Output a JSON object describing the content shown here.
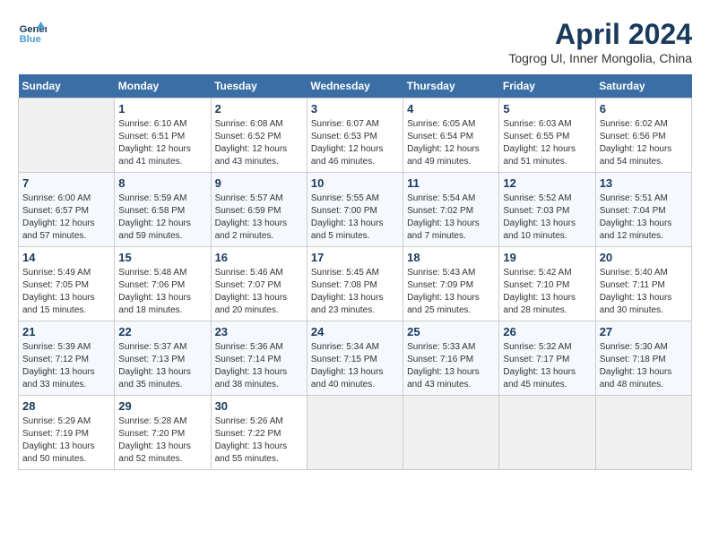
{
  "header": {
    "logo_line1": "General",
    "logo_line2": "Blue",
    "month_title": "April 2024",
    "location": "Togrog Ul, Inner Mongolia, China"
  },
  "days_of_week": [
    "Sunday",
    "Monday",
    "Tuesday",
    "Wednesday",
    "Thursday",
    "Friday",
    "Saturday"
  ],
  "weeks": [
    [
      {
        "day": "",
        "info": ""
      },
      {
        "day": "1",
        "info": "Sunrise: 6:10 AM\nSunset: 6:51 PM\nDaylight: 12 hours\nand 41 minutes."
      },
      {
        "day": "2",
        "info": "Sunrise: 6:08 AM\nSunset: 6:52 PM\nDaylight: 12 hours\nand 43 minutes."
      },
      {
        "day": "3",
        "info": "Sunrise: 6:07 AM\nSunset: 6:53 PM\nDaylight: 12 hours\nand 46 minutes."
      },
      {
        "day": "4",
        "info": "Sunrise: 6:05 AM\nSunset: 6:54 PM\nDaylight: 12 hours\nand 49 minutes."
      },
      {
        "day": "5",
        "info": "Sunrise: 6:03 AM\nSunset: 6:55 PM\nDaylight: 12 hours\nand 51 minutes."
      },
      {
        "day": "6",
        "info": "Sunrise: 6:02 AM\nSunset: 6:56 PM\nDaylight: 12 hours\nand 54 minutes."
      }
    ],
    [
      {
        "day": "7",
        "info": "Sunrise: 6:00 AM\nSunset: 6:57 PM\nDaylight: 12 hours\nand 57 minutes."
      },
      {
        "day": "8",
        "info": "Sunrise: 5:59 AM\nSunset: 6:58 PM\nDaylight: 12 hours\nand 59 minutes."
      },
      {
        "day": "9",
        "info": "Sunrise: 5:57 AM\nSunset: 6:59 PM\nDaylight: 13 hours\nand 2 minutes."
      },
      {
        "day": "10",
        "info": "Sunrise: 5:55 AM\nSunset: 7:00 PM\nDaylight: 13 hours\nand 5 minutes."
      },
      {
        "day": "11",
        "info": "Sunrise: 5:54 AM\nSunset: 7:02 PM\nDaylight: 13 hours\nand 7 minutes."
      },
      {
        "day": "12",
        "info": "Sunrise: 5:52 AM\nSunset: 7:03 PM\nDaylight: 13 hours\nand 10 minutes."
      },
      {
        "day": "13",
        "info": "Sunrise: 5:51 AM\nSunset: 7:04 PM\nDaylight: 13 hours\nand 12 minutes."
      }
    ],
    [
      {
        "day": "14",
        "info": "Sunrise: 5:49 AM\nSunset: 7:05 PM\nDaylight: 13 hours\nand 15 minutes."
      },
      {
        "day": "15",
        "info": "Sunrise: 5:48 AM\nSunset: 7:06 PM\nDaylight: 13 hours\nand 18 minutes."
      },
      {
        "day": "16",
        "info": "Sunrise: 5:46 AM\nSunset: 7:07 PM\nDaylight: 13 hours\nand 20 minutes."
      },
      {
        "day": "17",
        "info": "Sunrise: 5:45 AM\nSunset: 7:08 PM\nDaylight: 13 hours\nand 23 minutes."
      },
      {
        "day": "18",
        "info": "Sunrise: 5:43 AM\nSunset: 7:09 PM\nDaylight: 13 hours\nand 25 minutes."
      },
      {
        "day": "19",
        "info": "Sunrise: 5:42 AM\nSunset: 7:10 PM\nDaylight: 13 hours\nand 28 minutes."
      },
      {
        "day": "20",
        "info": "Sunrise: 5:40 AM\nSunset: 7:11 PM\nDaylight: 13 hours\nand 30 minutes."
      }
    ],
    [
      {
        "day": "21",
        "info": "Sunrise: 5:39 AM\nSunset: 7:12 PM\nDaylight: 13 hours\nand 33 minutes."
      },
      {
        "day": "22",
        "info": "Sunrise: 5:37 AM\nSunset: 7:13 PM\nDaylight: 13 hours\nand 35 minutes."
      },
      {
        "day": "23",
        "info": "Sunrise: 5:36 AM\nSunset: 7:14 PM\nDaylight: 13 hours\nand 38 minutes."
      },
      {
        "day": "24",
        "info": "Sunrise: 5:34 AM\nSunset: 7:15 PM\nDaylight: 13 hours\nand 40 minutes."
      },
      {
        "day": "25",
        "info": "Sunrise: 5:33 AM\nSunset: 7:16 PM\nDaylight: 13 hours\nand 43 minutes."
      },
      {
        "day": "26",
        "info": "Sunrise: 5:32 AM\nSunset: 7:17 PM\nDaylight: 13 hours\nand 45 minutes."
      },
      {
        "day": "27",
        "info": "Sunrise: 5:30 AM\nSunset: 7:18 PM\nDaylight: 13 hours\nand 48 minutes."
      }
    ],
    [
      {
        "day": "28",
        "info": "Sunrise: 5:29 AM\nSunset: 7:19 PM\nDaylight: 13 hours\nand 50 minutes."
      },
      {
        "day": "29",
        "info": "Sunrise: 5:28 AM\nSunset: 7:20 PM\nDaylight: 13 hours\nand 52 minutes."
      },
      {
        "day": "30",
        "info": "Sunrise: 5:26 AM\nSunset: 7:22 PM\nDaylight: 13 hours\nand 55 minutes."
      },
      {
        "day": "",
        "info": ""
      },
      {
        "day": "",
        "info": ""
      },
      {
        "day": "",
        "info": ""
      },
      {
        "day": "",
        "info": ""
      }
    ]
  ]
}
